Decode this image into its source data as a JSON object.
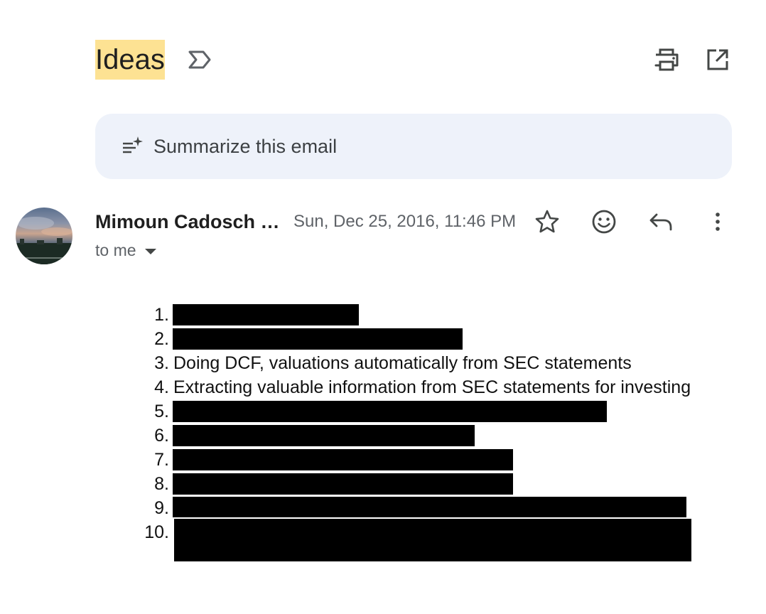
{
  "subject": "Ideas",
  "summarize": {
    "label": "Summarize this email"
  },
  "sender": {
    "name": "Mimoun Cadosch …",
    "date": "Sun, Dec 25, 2016, 11:46 PM",
    "recipient": "to me"
  },
  "body": {
    "items": [
      {
        "num": "1.",
        "text": "",
        "redacted": true
      },
      {
        "num": "2.",
        "text": "",
        "redacted": true
      },
      {
        "num": "3.",
        "text": "Doing DCF, valuations automatically from SEC statements",
        "redacted": false
      },
      {
        "num": "4.",
        "text": "Extracting valuable information from SEC statements for investing",
        "redacted": false
      },
      {
        "num": "5.",
        "text": "",
        "redacted": true
      },
      {
        "num": "6.",
        "text": "",
        "redacted": true
      },
      {
        "num": "7.",
        "text": "",
        "redacted": true
      },
      {
        "num": "8.",
        "text": "",
        "redacted": true
      },
      {
        "num": "9.",
        "text": "",
        "redacted": true
      },
      {
        "num": "10.",
        "text": "",
        "redacted": true
      }
    ]
  },
  "icons": {
    "label": "label-icon",
    "print": "print-icon",
    "popout": "open-in-new-window-icon",
    "summarize": "summarize-sparkle-icon",
    "star": "star-icon",
    "emoji": "emoji-reaction-icon",
    "reply": "reply-icon",
    "more": "more-vertical-icon"
  },
  "colors": {
    "subject_highlight": "#fde293",
    "summarize_bg": "#eef2fa",
    "secondary_text": "#5f6368",
    "redaction": "#000000"
  }
}
